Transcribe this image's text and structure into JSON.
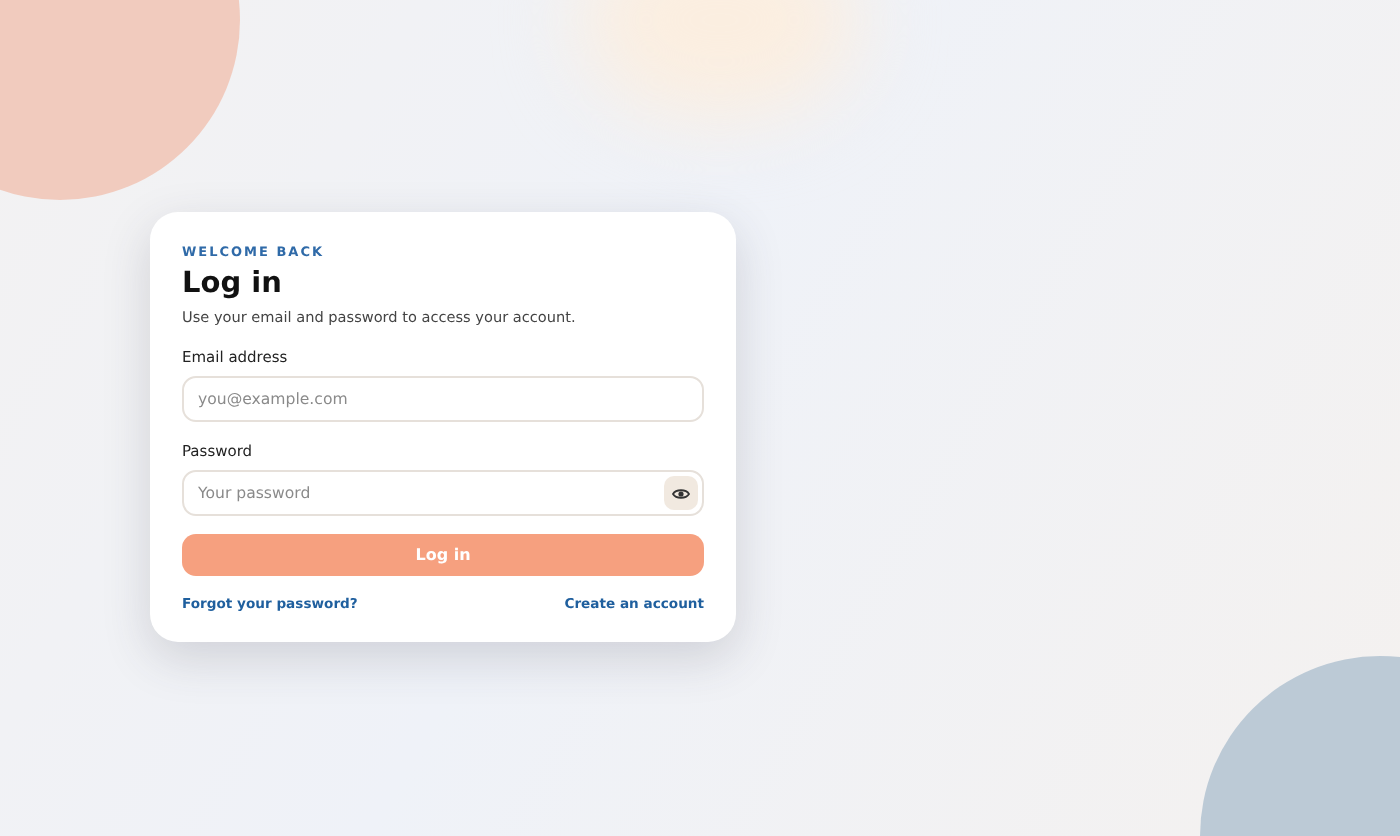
{
  "card": {
    "eyebrow": "WELCOME BACK",
    "title": "Log in",
    "subtitle": "Use your email and password to access your account.",
    "fields": [
      {
        "label": "Email address",
        "placeholder": "you@example.com",
        "kind": "text"
      },
      {
        "label": "Password",
        "placeholder": "Your password",
        "kind": "password"
      }
    ],
    "submit": "Log in",
    "links": [
      "Forgot your password?",
      "Create an account"
    ]
  }
}
